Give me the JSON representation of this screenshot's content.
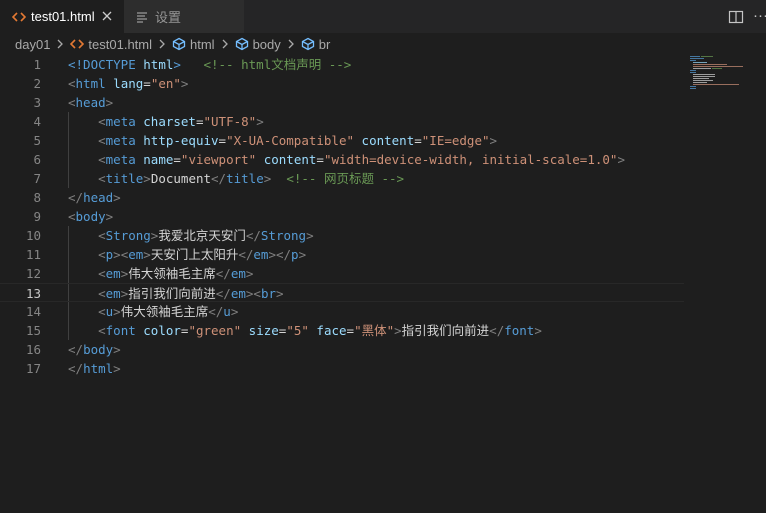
{
  "tabs": [
    {
      "label": "test01.html",
      "icon": "html-file-icon",
      "active": true
    },
    {
      "label": "设置",
      "icon": "settings-icon",
      "active": false
    }
  ],
  "breadcrumb": {
    "folder": "day01",
    "file": "test01.html",
    "symbols": [
      "html",
      "body",
      "br"
    ]
  },
  "editor": {
    "current_line": 13,
    "lines": [
      {
        "n": "1",
        "tokens": [
          {
            "t": "<!DOCTYPE ",
            "c": "tag"
          },
          {
            "t": "html",
            "c": "attr"
          },
          {
            "t": ">",
            "c": "tag"
          },
          {
            "t": "   ",
            "c": "txt"
          },
          {
            "t": "<!-- html文档声明 -->",
            "c": "com"
          }
        ]
      },
      {
        "n": "2",
        "tokens": [
          {
            "t": "<",
            "c": "br"
          },
          {
            "t": "html",
            "c": "tag"
          },
          {
            "t": " ",
            "c": "txt"
          },
          {
            "t": "lang",
            "c": "attr"
          },
          {
            "t": "=",
            "c": "txt"
          },
          {
            "t": "\"en\"",
            "c": "str"
          },
          {
            "t": ">",
            "c": "br"
          }
        ]
      },
      {
        "n": "3",
        "tokens": [
          {
            "t": "<",
            "c": "br"
          },
          {
            "t": "head",
            "c": "tag"
          },
          {
            "t": ">",
            "c": "br"
          }
        ]
      },
      {
        "n": "4",
        "tokens": [
          {
            "t": "    ",
            "c": "txt"
          },
          {
            "t": "<",
            "c": "br"
          },
          {
            "t": "meta",
            "c": "tag"
          },
          {
            "t": " ",
            "c": "txt"
          },
          {
            "t": "charset",
            "c": "attr"
          },
          {
            "t": "=",
            "c": "txt"
          },
          {
            "t": "\"UTF-8\"",
            "c": "str"
          },
          {
            "t": ">",
            "c": "br"
          }
        ]
      },
      {
        "n": "5",
        "tokens": [
          {
            "t": "    ",
            "c": "txt"
          },
          {
            "t": "<",
            "c": "br"
          },
          {
            "t": "meta",
            "c": "tag"
          },
          {
            "t": " ",
            "c": "txt"
          },
          {
            "t": "http-equiv",
            "c": "attr"
          },
          {
            "t": "=",
            "c": "txt"
          },
          {
            "t": "\"X-UA-Compatible\"",
            "c": "str"
          },
          {
            "t": " ",
            "c": "txt"
          },
          {
            "t": "content",
            "c": "attr"
          },
          {
            "t": "=",
            "c": "txt"
          },
          {
            "t": "\"IE=edge\"",
            "c": "str"
          },
          {
            "t": ">",
            "c": "br"
          }
        ]
      },
      {
        "n": "6",
        "tokens": [
          {
            "t": "    ",
            "c": "txt"
          },
          {
            "t": "<",
            "c": "br"
          },
          {
            "t": "meta",
            "c": "tag"
          },
          {
            "t": " ",
            "c": "txt"
          },
          {
            "t": "name",
            "c": "attr"
          },
          {
            "t": "=",
            "c": "txt"
          },
          {
            "t": "\"viewport\"",
            "c": "str"
          },
          {
            "t": " ",
            "c": "txt"
          },
          {
            "t": "content",
            "c": "attr"
          },
          {
            "t": "=",
            "c": "txt"
          },
          {
            "t": "\"width=device-width, initial-scale=1.0\"",
            "c": "str"
          },
          {
            "t": ">",
            "c": "br"
          }
        ]
      },
      {
        "n": "7",
        "tokens": [
          {
            "t": "    ",
            "c": "txt"
          },
          {
            "t": "<",
            "c": "br"
          },
          {
            "t": "title",
            "c": "tag"
          },
          {
            "t": ">",
            "c": "br"
          },
          {
            "t": "Document",
            "c": "txt"
          },
          {
            "t": "</",
            "c": "br"
          },
          {
            "t": "title",
            "c": "tag"
          },
          {
            "t": ">",
            "c": "br"
          },
          {
            "t": "  ",
            "c": "txt"
          },
          {
            "t": "<!-- 网页标题 -->",
            "c": "com"
          }
        ]
      },
      {
        "n": "8",
        "tokens": [
          {
            "t": "</",
            "c": "br"
          },
          {
            "t": "head",
            "c": "tag"
          },
          {
            "t": ">",
            "c": "br"
          }
        ]
      },
      {
        "n": "9",
        "tokens": [
          {
            "t": "<",
            "c": "br"
          },
          {
            "t": "body",
            "c": "tag"
          },
          {
            "t": ">",
            "c": "br"
          }
        ]
      },
      {
        "n": "10",
        "tokens": [
          {
            "t": "    ",
            "c": "txt"
          },
          {
            "t": "<",
            "c": "br"
          },
          {
            "t": "Strong",
            "c": "tag"
          },
          {
            "t": ">",
            "c": "br"
          },
          {
            "t": "我爱北京天安门",
            "c": "txt"
          },
          {
            "t": "</",
            "c": "br"
          },
          {
            "t": "Strong",
            "c": "tag"
          },
          {
            "t": ">",
            "c": "br"
          }
        ]
      },
      {
        "n": "11",
        "tokens": [
          {
            "t": "    ",
            "c": "txt"
          },
          {
            "t": "<",
            "c": "br"
          },
          {
            "t": "p",
            "c": "tag"
          },
          {
            "t": "><",
            "c": "br"
          },
          {
            "t": "em",
            "c": "tag"
          },
          {
            "t": ">",
            "c": "br"
          },
          {
            "t": "天安门上太阳升",
            "c": "txt"
          },
          {
            "t": "</",
            "c": "br"
          },
          {
            "t": "em",
            "c": "tag"
          },
          {
            "t": "></",
            "c": "br"
          },
          {
            "t": "p",
            "c": "tag"
          },
          {
            "t": ">",
            "c": "br"
          }
        ]
      },
      {
        "n": "12",
        "tokens": [
          {
            "t": "    ",
            "c": "txt"
          },
          {
            "t": "<",
            "c": "br"
          },
          {
            "t": "em",
            "c": "tag"
          },
          {
            "t": ">",
            "c": "br"
          },
          {
            "t": "伟大领袖毛主席",
            "c": "txt"
          },
          {
            "t": "</",
            "c": "br"
          },
          {
            "t": "em",
            "c": "tag"
          },
          {
            "t": ">",
            "c": "br"
          }
        ]
      },
      {
        "n": "13",
        "tokens": [
          {
            "t": "    ",
            "c": "txt"
          },
          {
            "t": "<",
            "c": "br"
          },
          {
            "t": "em",
            "c": "tag"
          },
          {
            "t": ">",
            "c": "br"
          },
          {
            "t": "指引我们向前进",
            "c": "txt"
          },
          {
            "t": "</",
            "c": "br"
          },
          {
            "t": "em",
            "c": "tag"
          },
          {
            "t": "><",
            "c": "br"
          },
          {
            "t": "br",
            "c": "tag"
          },
          {
            "t": ">",
            "c": "br"
          }
        ]
      },
      {
        "n": "14",
        "tokens": [
          {
            "t": "    ",
            "c": "txt"
          },
          {
            "t": "<",
            "c": "br"
          },
          {
            "t": "u",
            "c": "tag"
          },
          {
            "t": ">",
            "c": "br"
          },
          {
            "t": "伟大领袖毛主席",
            "c": "txt"
          },
          {
            "t": "</",
            "c": "br"
          },
          {
            "t": "u",
            "c": "tag"
          },
          {
            "t": ">",
            "c": "br"
          }
        ]
      },
      {
        "n": "15",
        "tokens": [
          {
            "t": "    ",
            "c": "txt"
          },
          {
            "t": "<",
            "c": "br"
          },
          {
            "t": "font",
            "c": "tag"
          },
          {
            "t": " ",
            "c": "txt"
          },
          {
            "t": "color",
            "c": "attr"
          },
          {
            "t": "=",
            "c": "txt"
          },
          {
            "t": "\"green\"",
            "c": "str"
          },
          {
            "t": " ",
            "c": "txt"
          },
          {
            "t": "size",
            "c": "attr"
          },
          {
            "t": "=",
            "c": "txt"
          },
          {
            "t": "\"5\"",
            "c": "str"
          },
          {
            "t": " ",
            "c": "txt"
          },
          {
            "t": "face",
            "c": "attr"
          },
          {
            "t": "=",
            "c": "txt"
          },
          {
            "t": "\"黑体\"",
            "c": "str"
          },
          {
            "t": ">",
            "c": "br"
          },
          {
            "t": "指引我们向前进",
            "c": "txt"
          },
          {
            "t": "</",
            "c": "br"
          },
          {
            "t": "font",
            "c": "tag"
          },
          {
            "t": ">",
            "c": "br"
          }
        ]
      },
      {
        "n": "16",
        "tokens": [
          {
            "t": "</",
            "c": "br"
          },
          {
            "t": "body",
            "c": "tag"
          },
          {
            "t": ">",
            "c": "br"
          }
        ]
      },
      {
        "n": "17",
        "tokens": [
          {
            "t": "</",
            "c": "br"
          },
          {
            "t": "html",
            "c": "tag"
          },
          {
            "t": ">",
            "c": "br"
          }
        ]
      }
    ]
  },
  "colors": {
    "editor_bg": "#1e1e1e",
    "tab_bar_bg": "#252526",
    "tag": "#569cd6",
    "attribute": "#9cdcfe",
    "string": "#ce9178",
    "comment": "#6a9955",
    "punctuation": "#808080",
    "html_icon": "#e37933"
  }
}
